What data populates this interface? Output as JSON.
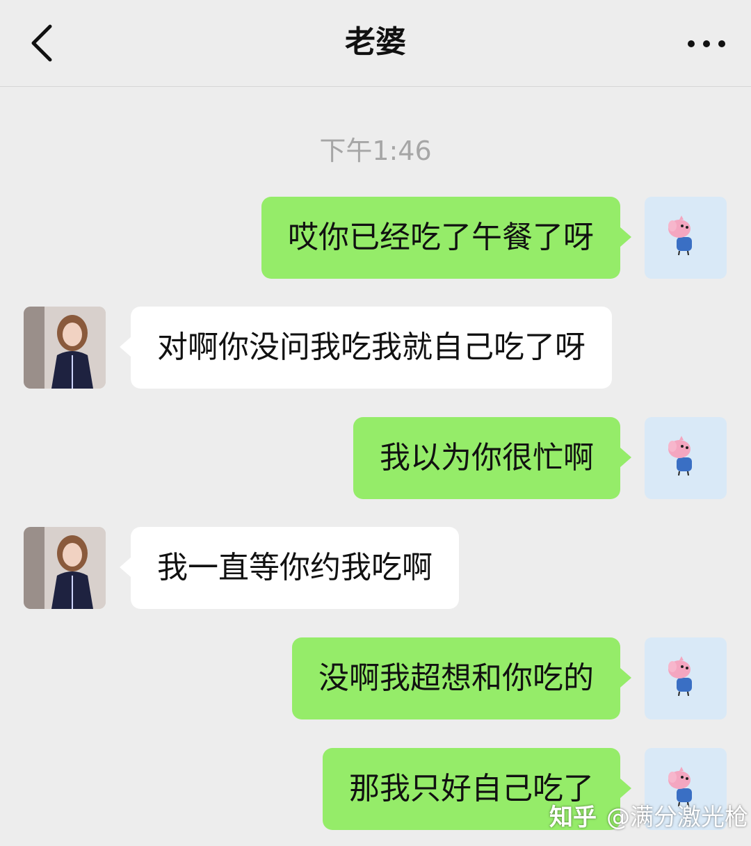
{
  "header": {
    "title": "老婆",
    "back_icon": "chevron-left-icon",
    "more_icon": "more-dots-icon"
  },
  "timestamp": "下午1:46",
  "colors": {
    "sent_bubble": "#95ec69",
    "received_bubble": "#ffffff",
    "background": "#ededed"
  },
  "messages": [
    {
      "sender": "me",
      "text": "哎你已经吃了午餐了呀"
    },
    {
      "sender": "her",
      "text": "对啊你没问我吃我就自己吃了呀"
    },
    {
      "sender": "me",
      "text": "我以为你很忙啊"
    },
    {
      "sender": "her",
      "text": "我一直等你约我吃啊"
    },
    {
      "sender": "me",
      "text": "没啊我超想和你吃的"
    },
    {
      "sender": "me",
      "text": "那我只好自己吃了"
    }
  ],
  "watermark": {
    "brand": "知乎",
    "handle": "@满分激光枪"
  }
}
